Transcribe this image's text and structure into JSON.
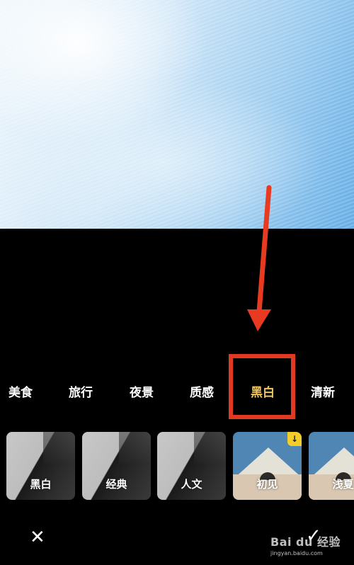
{
  "categories": [
    {
      "label": "美食",
      "active": false
    },
    {
      "label": "旅行",
      "active": false
    },
    {
      "label": "夜景",
      "active": false
    },
    {
      "label": "质感",
      "active": false
    },
    {
      "label": "黑白",
      "active": true
    },
    {
      "label": "清新",
      "active": false
    }
  ],
  "filters": [
    {
      "label": "黑白",
      "style": "bw",
      "download": false
    },
    {
      "label": "经典",
      "style": "bw",
      "download": false
    },
    {
      "label": "人文",
      "style": "bw",
      "download": false
    },
    {
      "label": "初见",
      "style": "house",
      "download": true
    },
    {
      "label": "浅夏",
      "style": "house",
      "download": false
    }
  ],
  "actions": {
    "cancel_icon": "✕",
    "confirm_icon": "✓"
  },
  "watermark": {
    "brand": "Bai du 经验",
    "url": "jingyan.baidu.com"
  },
  "colors": {
    "active_category": "#f0c75e",
    "annotation": "#e23a22",
    "download_badge": "#f3cd2c"
  }
}
